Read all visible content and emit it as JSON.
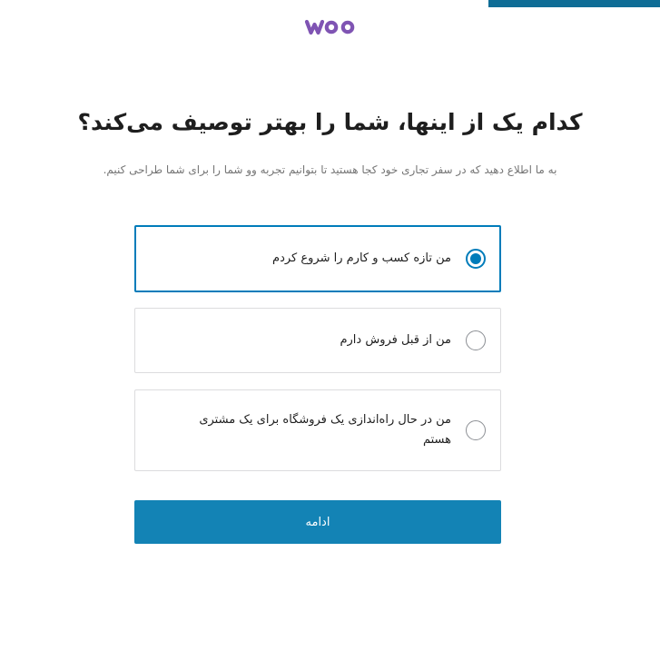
{
  "brand": {
    "logo_text": "woo",
    "logo_color": "#7f54b3"
  },
  "progress": {
    "fraction": 0.26,
    "color": "#0f6d96"
  },
  "title": "کدام یک از اینها، شما را بهتر توصیف می‌کند؟",
  "subtitle": "به ما اطلاع دهید که در سفر تجاری خود کجا هستید تا بتوانیم تجربه وو شما را برای شما طراحی کنیم.",
  "options": [
    {
      "label": "من تازه کسب و کارم را شروع کردم",
      "selected": true
    },
    {
      "label": "من از قبل فروش دارم",
      "selected": false
    },
    {
      "label": "من در حال راه‌اندازی یک فروشگاه برای یک مشتری هستم",
      "selected": false
    }
  ],
  "continue_button": {
    "label": "ادامه",
    "color": "#1383b5"
  },
  "accent_color": "#007cba"
}
